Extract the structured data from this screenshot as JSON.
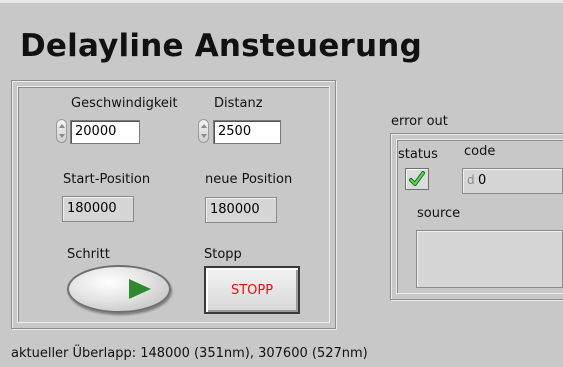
{
  "title": "Delayline Ansteuerung",
  "controls": {
    "speed": {
      "label": "Geschwindigkeit",
      "value": "20000"
    },
    "distance": {
      "label": "Distanz",
      "value": "2500"
    },
    "start_position": {
      "label": "Start-Position",
      "value": "180000"
    },
    "new_position": {
      "label": "neue Position",
      "value": "180000"
    },
    "step": {
      "label": "Schritt"
    },
    "stop": {
      "label": "Stopp",
      "button_text": "STOPP"
    }
  },
  "error_out": {
    "label": "error out",
    "status_label": "status",
    "code_label": "code",
    "code_prefix": "d",
    "code_value": "0",
    "source_label": "source",
    "source_value": ""
  },
  "overlap_text": "aktueller Überlapp: 148000 (351nm),  307600 (527nm)",
  "colors": {
    "stop_text": "#e01010",
    "step_arrow": "#2f8a2f",
    "status_check": "#2aa02a"
  }
}
